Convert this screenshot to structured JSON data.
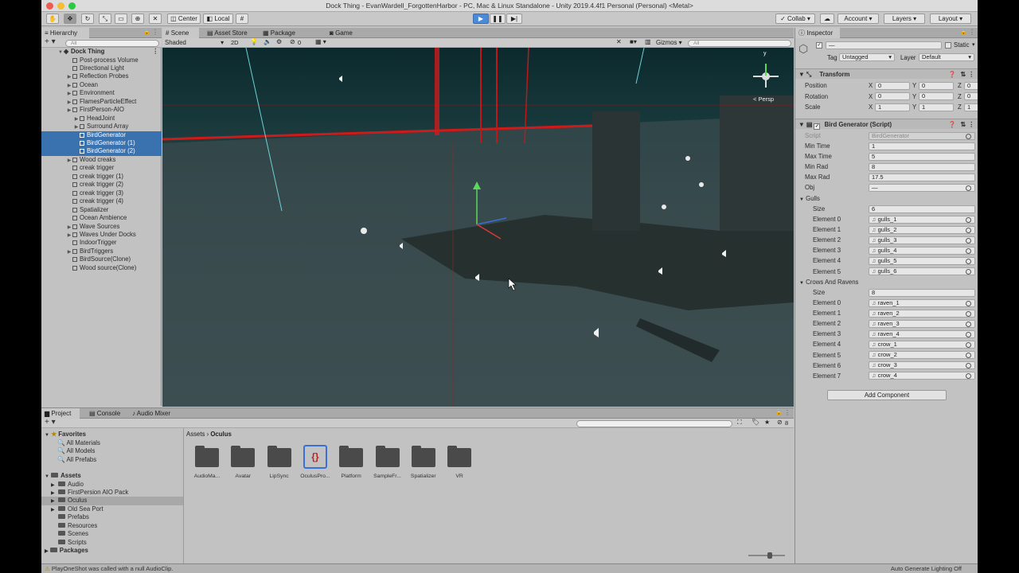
{
  "window": {
    "title": "Dock Thing - EvanWardell_ForgottenHarbor - PC, Mac & Linux Standalone - Unity 2019.4.4f1 Personal (Personal) <Metal>"
  },
  "toolbar": {
    "pivot_label": "Center",
    "space_label": "Local",
    "collab_label": "Collab",
    "account_label": "Account",
    "layers_label": "Layers",
    "layout_label": "Layout"
  },
  "hierarchy": {
    "tab_label": "Hierarchy",
    "search_placeholder": "All",
    "scene_name": "Dock Thing",
    "items": [
      {
        "label": "Post-process Volume",
        "depth": 1,
        "expandable": false,
        "selected": false
      },
      {
        "label": "Directional Light",
        "depth": 1,
        "expandable": false,
        "selected": false
      },
      {
        "label": "Reflection Probes",
        "depth": 1,
        "expandable": true,
        "selected": false
      },
      {
        "label": "Ocean",
        "depth": 1,
        "expandable": true,
        "selected": false
      },
      {
        "label": "Environment",
        "depth": 1,
        "expandable": true,
        "selected": false
      },
      {
        "label": "FlamesParticleEffect",
        "depth": 1,
        "expandable": true,
        "selected": false
      },
      {
        "label": "FirstPerson-AIO",
        "depth": 1,
        "expandable": true,
        "selected": false
      },
      {
        "label": "HeadJoint",
        "depth": 2,
        "expandable": true,
        "selected": false
      },
      {
        "label": "Surround Array",
        "depth": 2,
        "expandable": true,
        "selected": false
      },
      {
        "label": "BirdGenerator",
        "depth": 2,
        "expandable": false,
        "selected": true
      },
      {
        "label": "BirdGenerator (1)",
        "depth": 2,
        "expandable": false,
        "selected": true
      },
      {
        "label": "BirdGenerator (2)",
        "depth": 2,
        "expandable": false,
        "selected": true
      },
      {
        "label": "Wood creaks",
        "depth": 1,
        "expandable": true,
        "selected": false
      },
      {
        "label": "creak trigger",
        "depth": 1,
        "expandable": false,
        "selected": false
      },
      {
        "label": "creak trigger (1)",
        "depth": 1,
        "expandable": false,
        "selected": false
      },
      {
        "label": "creak trigger (2)",
        "depth": 1,
        "expandable": false,
        "selected": false
      },
      {
        "label": "creak trigger (3)",
        "depth": 1,
        "expandable": false,
        "selected": false
      },
      {
        "label": "creak trigger (4)",
        "depth": 1,
        "expandable": false,
        "selected": false
      },
      {
        "label": "Spatializer",
        "depth": 1,
        "expandable": false,
        "selected": false
      },
      {
        "label": "Ocean Ambience",
        "depth": 1,
        "expandable": false,
        "selected": false
      },
      {
        "label": "Wave Sources",
        "depth": 1,
        "expandable": true,
        "selected": false
      },
      {
        "label": "Waves Under Docks",
        "depth": 1,
        "expandable": true,
        "selected": false
      },
      {
        "label": "IndoorTrigger",
        "depth": 1,
        "expandable": false,
        "selected": false
      },
      {
        "label": "BirdTriggers",
        "depth": 1,
        "expandable": true,
        "selected": false
      },
      {
        "label": "BirdSource(Clone)",
        "depth": 1,
        "expandable": false,
        "selected": false
      },
      {
        "label": "Wood source(Clone)",
        "depth": 1,
        "expandable": false,
        "selected": false
      }
    ]
  },
  "scene": {
    "tabs": [
      "Scene",
      "Asset Store",
      "Package Manager",
      "Game"
    ],
    "shading_mode": "Shaded",
    "mode_2d": "2D",
    "fx_count": "0",
    "gizmos_label": "Gizmos",
    "search_placeholder": "All",
    "persp_label": "< Persp",
    "gizmo_y_label": "y"
  },
  "inspector": {
    "tab_label": "Inspector",
    "object_name": "—",
    "static_label": "Static",
    "tag_label": "Tag",
    "tag_value": "Untagged",
    "layer_label": "Layer",
    "layer_value": "Default",
    "transform": {
      "title": "Transform",
      "rows": [
        {
          "label": "Position",
          "x": "0",
          "y": "0",
          "z": "0"
        },
        {
          "label": "Rotation",
          "x": "0",
          "y": "0",
          "z": "0"
        },
        {
          "label": "Scale",
          "x": "1",
          "y": "1",
          "z": "1"
        }
      ]
    },
    "bird_generator": {
      "title": "Bird Generator (Script)",
      "script_label": "Script",
      "script_value": "BirdGenerator",
      "fields": [
        {
          "label": "Min Time",
          "value": "1"
        },
        {
          "label": "Max Time",
          "value": "5"
        },
        {
          "label": "Min Rad",
          "value": "8"
        },
        {
          "label": "Max Rad",
          "value": "17.5"
        },
        {
          "label": "Obj",
          "value": "—"
        }
      ],
      "gulls": {
        "label": "Gulls",
        "size_label": "Size",
        "size": "6",
        "elements": [
          {
            "label": "Element 0",
            "value": "gulls_1"
          },
          {
            "label": "Element 1",
            "value": "gulls_2"
          },
          {
            "label": "Element 2",
            "value": "gulls_3"
          },
          {
            "label": "Element 3",
            "value": "gulls_4"
          },
          {
            "label": "Element 4",
            "value": "gulls_5"
          },
          {
            "label": "Element 5",
            "value": "gulls_6"
          }
        ]
      },
      "crows": {
        "label": "Crows And Ravens",
        "size_label": "Size",
        "size": "8",
        "elements": [
          {
            "label": "Element 0",
            "value": "raven_1"
          },
          {
            "label": "Element 1",
            "value": "raven_2"
          },
          {
            "label": "Element 2",
            "value": "raven_3"
          },
          {
            "label": "Element 3",
            "value": "raven_4"
          },
          {
            "label": "Element 4",
            "value": "crow_1"
          },
          {
            "label": "Element 5",
            "value": "crow_2"
          },
          {
            "label": "Element 6",
            "value": "crow_3"
          },
          {
            "label": "Element 7",
            "value": "crow_4"
          }
        ]
      }
    },
    "add_component_label": "Add Component"
  },
  "project": {
    "tabs": [
      "Project",
      "Console",
      "Audio Mixer"
    ],
    "hidden_count": "8",
    "breadcrumb": [
      "Assets",
      "Oculus"
    ],
    "favorites_label": "Favorites",
    "favorites": [
      "All Materials",
      "All Models",
      "All Prefabs"
    ],
    "assets_label": "Assets",
    "asset_tree": [
      {
        "label": "Audio",
        "expandable": true,
        "selected": false
      },
      {
        "label": "FirstPersion AIO Pack",
        "expandable": true,
        "selected": false
      },
      {
        "label": "Oculus",
        "expandable": true,
        "selected": true
      },
      {
        "label": "Old Sea Port",
        "expandable": true,
        "selected": false
      },
      {
        "label": "Prefabs",
        "expandable": false,
        "selected": false
      },
      {
        "label": "Resources",
        "expandable": false,
        "selected": false
      },
      {
        "label": "Scenes",
        "expandable": false,
        "selected": false
      },
      {
        "label": "Scripts",
        "expandable": false,
        "selected": false
      }
    ],
    "packages_label": "Packages",
    "grid_items": [
      "AudioMa...",
      "Avatar",
      "LipSync",
      "OculusPro...",
      "Platform",
      "SampleFr...",
      "Spatializer",
      "VR"
    ]
  },
  "status_bar": {
    "message": "PlayOneShot was called with a null AudioClip.",
    "right_text": "Auto Generate Lighting Off"
  }
}
